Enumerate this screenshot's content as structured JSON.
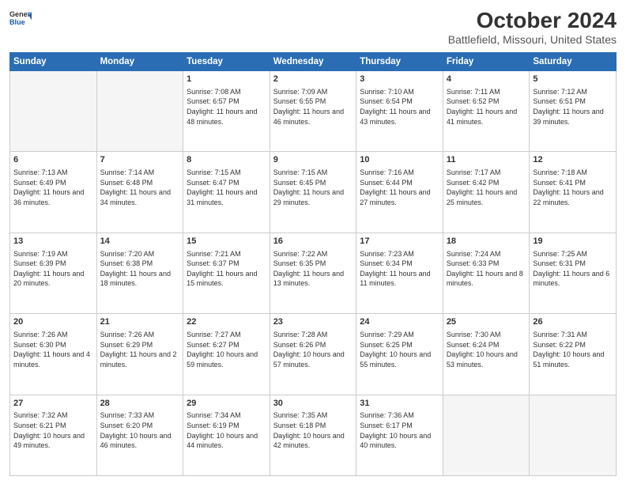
{
  "header": {
    "logo_general": "General",
    "logo_blue": "Blue",
    "title": "October 2024",
    "subtitle": "Battlefield, Missouri, United States"
  },
  "days_of_week": [
    "Sunday",
    "Monday",
    "Tuesday",
    "Wednesday",
    "Thursday",
    "Friday",
    "Saturday"
  ],
  "weeks": [
    [
      {
        "day": null,
        "sunrise": null,
        "sunset": null,
        "daylight": null
      },
      {
        "day": null,
        "sunrise": null,
        "sunset": null,
        "daylight": null
      },
      {
        "day": "1",
        "sunrise": "Sunrise: 7:08 AM",
        "sunset": "Sunset: 6:57 PM",
        "daylight": "Daylight: 11 hours and 48 minutes."
      },
      {
        "day": "2",
        "sunrise": "Sunrise: 7:09 AM",
        "sunset": "Sunset: 6:55 PM",
        "daylight": "Daylight: 11 hours and 46 minutes."
      },
      {
        "day": "3",
        "sunrise": "Sunrise: 7:10 AM",
        "sunset": "Sunset: 6:54 PM",
        "daylight": "Daylight: 11 hours and 43 minutes."
      },
      {
        "day": "4",
        "sunrise": "Sunrise: 7:11 AM",
        "sunset": "Sunset: 6:52 PM",
        "daylight": "Daylight: 11 hours and 41 minutes."
      },
      {
        "day": "5",
        "sunrise": "Sunrise: 7:12 AM",
        "sunset": "Sunset: 6:51 PM",
        "daylight": "Daylight: 11 hours and 39 minutes."
      }
    ],
    [
      {
        "day": "6",
        "sunrise": "Sunrise: 7:13 AM",
        "sunset": "Sunset: 6:49 PM",
        "daylight": "Daylight: 11 hours and 36 minutes."
      },
      {
        "day": "7",
        "sunrise": "Sunrise: 7:14 AM",
        "sunset": "Sunset: 6:48 PM",
        "daylight": "Daylight: 11 hours and 34 minutes."
      },
      {
        "day": "8",
        "sunrise": "Sunrise: 7:15 AM",
        "sunset": "Sunset: 6:47 PM",
        "daylight": "Daylight: 11 hours and 31 minutes."
      },
      {
        "day": "9",
        "sunrise": "Sunrise: 7:15 AM",
        "sunset": "Sunset: 6:45 PM",
        "daylight": "Daylight: 11 hours and 29 minutes."
      },
      {
        "day": "10",
        "sunrise": "Sunrise: 7:16 AM",
        "sunset": "Sunset: 6:44 PM",
        "daylight": "Daylight: 11 hours and 27 minutes."
      },
      {
        "day": "11",
        "sunrise": "Sunrise: 7:17 AM",
        "sunset": "Sunset: 6:42 PM",
        "daylight": "Daylight: 11 hours and 25 minutes."
      },
      {
        "day": "12",
        "sunrise": "Sunrise: 7:18 AM",
        "sunset": "Sunset: 6:41 PM",
        "daylight": "Daylight: 11 hours and 22 minutes."
      }
    ],
    [
      {
        "day": "13",
        "sunrise": "Sunrise: 7:19 AM",
        "sunset": "Sunset: 6:39 PM",
        "daylight": "Daylight: 11 hours and 20 minutes."
      },
      {
        "day": "14",
        "sunrise": "Sunrise: 7:20 AM",
        "sunset": "Sunset: 6:38 PM",
        "daylight": "Daylight: 11 hours and 18 minutes."
      },
      {
        "day": "15",
        "sunrise": "Sunrise: 7:21 AM",
        "sunset": "Sunset: 6:37 PM",
        "daylight": "Daylight: 11 hours and 15 minutes."
      },
      {
        "day": "16",
        "sunrise": "Sunrise: 7:22 AM",
        "sunset": "Sunset: 6:35 PM",
        "daylight": "Daylight: 11 hours and 13 minutes."
      },
      {
        "day": "17",
        "sunrise": "Sunrise: 7:23 AM",
        "sunset": "Sunset: 6:34 PM",
        "daylight": "Daylight: 11 hours and 11 minutes."
      },
      {
        "day": "18",
        "sunrise": "Sunrise: 7:24 AM",
        "sunset": "Sunset: 6:33 PM",
        "daylight": "Daylight: 11 hours and 8 minutes."
      },
      {
        "day": "19",
        "sunrise": "Sunrise: 7:25 AM",
        "sunset": "Sunset: 6:31 PM",
        "daylight": "Daylight: 11 hours and 6 minutes."
      }
    ],
    [
      {
        "day": "20",
        "sunrise": "Sunrise: 7:26 AM",
        "sunset": "Sunset: 6:30 PM",
        "daylight": "Daylight: 11 hours and 4 minutes."
      },
      {
        "day": "21",
        "sunrise": "Sunrise: 7:26 AM",
        "sunset": "Sunset: 6:29 PM",
        "daylight": "Daylight: 11 hours and 2 minutes."
      },
      {
        "day": "22",
        "sunrise": "Sunrise: 7:27 AM",
        "sunset": "Sunset: 6:27 PM",
        "daylight": "Daylight: 10 hours and 59 minutes."
      },
      {
        "day": "23",
        "sunrise": "Sunrise: 7:28 AM",
        "sunset": "Sunset: 6:26 PM",
        "daylight": "Daylight: 10 hours and 57 minutes."
      },
      {
        "day": "24",
        "sunrise": "Sunrise: 7:29 AM",
        "sunset": "Sunset: 6:25 PM",
        "daylight": "Daylight: 10 hours and 55 minutes."
      },
      {
        "day": "25",
        "sunrise": "Sunrise: 7:30 AM",
        "sunset": "Sunset: 6:24 PM",
        "daylight": "Daylight: 10 hours and 53 minutes."
      },
      {
        "day": "26",
        "sunrise": "Sunrise: 7:31 AM",
        "sunset": "Sunset: 6:22 PM",
        "daylight": "Daylight: 10 hours and 51 minutes."
      }
    ],
    [
      {
        "day": "27",
        "sunrise": "Sunrise: 7:32 AM",
        "sunset": "Sunset: 6:21 PM",
        "daylight": "Daylight: 10 hours and 49 minutes."
      },
      {
        "day": "28",
        "sunrise": "Sunrise: 7:33 AM",
        "sunset": "Sunset: 6:20 PM",
        "daylight": "Daylight: 10 hours and 46 minutes."
      },
      {
        "day": "29",
        "sunrise": "Sunrise: 7:34 AM",
        "sunset": "Sunset: 6:19 PM",
        "daylight": "Daylight: 10 hours and 44 minutes."
      },
      {
        "day": "30",
        "sunrise": "Sunrise: 7:35 AM",
        "sunset": "Sunset: 6:18 PM",
        "daylight": "Daylight: 10 hours and 42 minutes."
      },
      {
        "day": "31",
        "sunrise": "Sunrise: 7:36 AM",
        "sunset": "Sunset: 6:17 PM",
        "daylight": "Daylight: 10 hours and 40 minutes."
      },
      {
        "day": null,
        "sunrise": null,
        "sunset": null,
        "daylight": null
      },
      {
        "day": null,
        "sunrise": null,
        "sunset": null,
        "daylight": null
      }
    ]
  ]
}
